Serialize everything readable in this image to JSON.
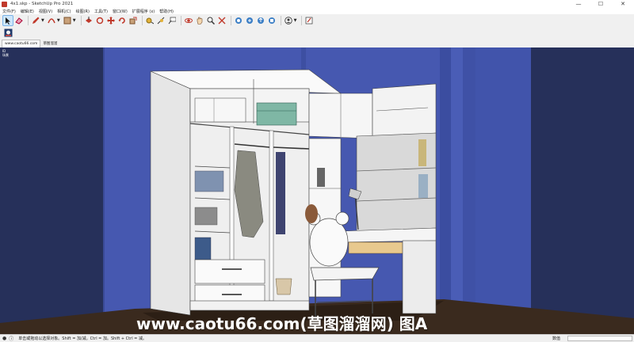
{
  "window": {
    "title": "4x1.skp - SketchUp Pro 2021",
    "minimize": "—",
    "maximize": "☐",
    "close": "✕"
  },
  "menu": {
    "items": [
      "文件(F)",
      "编辑(E)",
      "视图(V)",
      "相机(C)",
      "绘图(R)",
      "工具(T)",
      "窗口(W)",
      "扩展程序 (x)",
      "帮助(H)"
    ]
  },
  "tabs": [
    {
      "label": "www.caotu66.com"
    },
    {
      "label": "草图溜溜"
    }
  ],
  "viewport": {
    "labels": [
      "ID",
      "场景"
    ]
  },
  "watermark": "www.caotu66.com(草图溜溜网) 图A",
  "status": {
    "message": "单击或拖动以选择对象。Shift = 加/减。Ctrl = 加。Shift + Ctrl = 减。",
    "value_label": "数值",
    "value": ""
  },
  "colors": {
    "wall": "#4658b0",
    "wall_dark": "#26305a",
    "floor": "#3a2a1e",
    "cabinet": "#f2f2f2"
  }
}
